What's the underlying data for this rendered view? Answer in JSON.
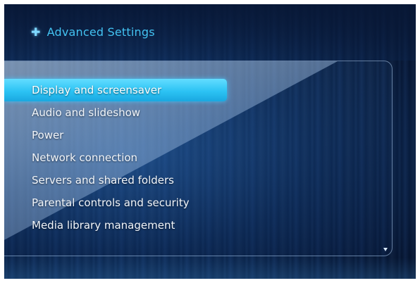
{
  "header": {
    "icon": "plus-icon",
    "title": "Advanced Settings"
  },
  "menu": {
    "selected_index": 0,
    "items": [
      {
        "label": "Display and screensaver"
      },
      {
        "label": "Audio and slideshow"
      },
      {
        "label": "Power"
      },
      {
        "label": "Network connection"
      },
      {
        "label": "Servers and shared folders"
      },
      {
        "label": "Parental controls and security"
      },
      {
        "label": "Media library management"
      }
    ],
    "more_indicator": "scroll-down-icon"
  },
  "colors": {
    "accent": "#2cc3f4",
    "title": "#43c3f2",
    "background": "#0c2a55"
  }
}
